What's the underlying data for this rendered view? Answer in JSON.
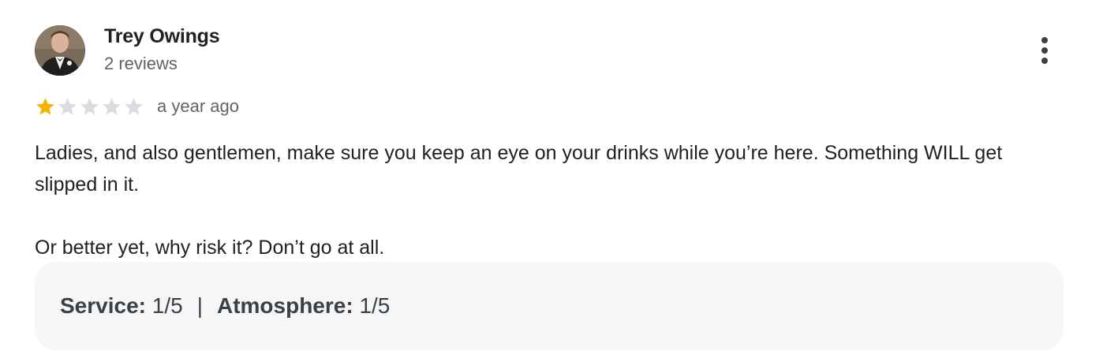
{
  "review": {
    "author": {
      "name": "Trey Owings",
      "meta": "2 reviews"
    },
    "rating": {
      "value": 1,
      "max": 5,
      "filled_color": "#f4b400",
      "empty_color": "#dadce0"
    },
    "date": "a year ago",
    "paragraphs": [
      "Ladies, and also gentlemen, make sure you keep an eye on your drinks while you’re here. Something WILL get slipped in it.",
      "Or better yet, why risk it? Don’t go at all."
    ],
    "attributes": {
      "service_label": "Service:",
      "service_value": "1/5",
      "separator": "|",
      "atmosphere_label": "Atmosphere:",
      "atmosphere_value": "1/5"
    },
    "more_icon": "more-vert-icon"
  }
}
